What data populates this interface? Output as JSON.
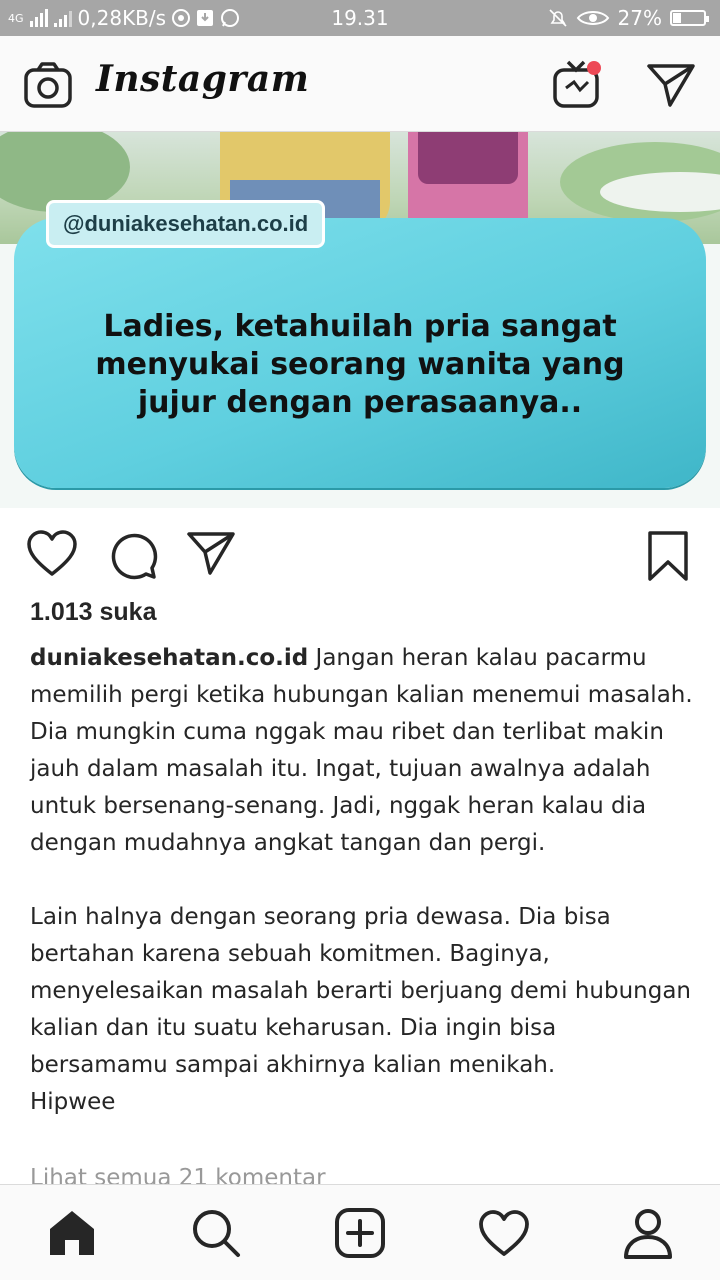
{
  "status_bar": {
    "network_label": "4G",
    "speed": "0,28KB/s",
    "time": "19.31",
    "battery_percent_text": "27%",
    "battery_level": 0.27
  },
  "header": {
    "app_title": "Instagram",
    "icons": [
      "camera-icon",
      "igtv-icon",
      "direct-message-icon"
    ],
    "notification_dot_color": "#ed4956"
  },
  "post": {
    "image": {
      "handle_text": "@duniakesehatan.co.id",
      "headline_lines": [
        "Ladies, ketahuilah pria sangat",
        "menyukai seorang wanita yang",
        "jujur dengan perasaanya.."
      ],
      "card_color": "#5fcfdf"
    },
    "actions": {
      "icons": [
        "heart-icon",
        "comment-icon",
        "share-icon",
        "bookmark-icon"
      ]
    },
    "likes_text": "1.013 suka",
    "caption": {
      "username": "duniakesehatan.co.id",
      "paragraph1": "Jangan heran kalau pacarmu memilih pergi ketika hubungan kalian menemui masalah. Dia mungkin cuma nggak mau ribet dan terlibat makin jauh dalam masalah itu. Ingat, tujuan awalnya adalah untuk bersenang-senang. Jadi, nggak heran kalau dia dengan mudahnya angkat tangan dan pergi.",
      "paragraph2": "Lain halnya dengan seorang pria dewasa. Dia bisa bertahan karena sebuah komitmen. Baginya, menyelesaikan masalah berarti berjuang demi hubungan kalian dan itu suatu keharusan. Dia ingin bisa bersamamu sampai akhirnya kalian menikah.",
      "paragraph3": "Hipwee"
    },
    "view_comments_text": "Lihat semua 21 komentar"
  },
  "bottom_nav": {
    "icons": [
      "home-icon",
      "search-icon",
      "new-post-icon",
      "activity-icon",
      "profile-icon"
    ]
  }
}
